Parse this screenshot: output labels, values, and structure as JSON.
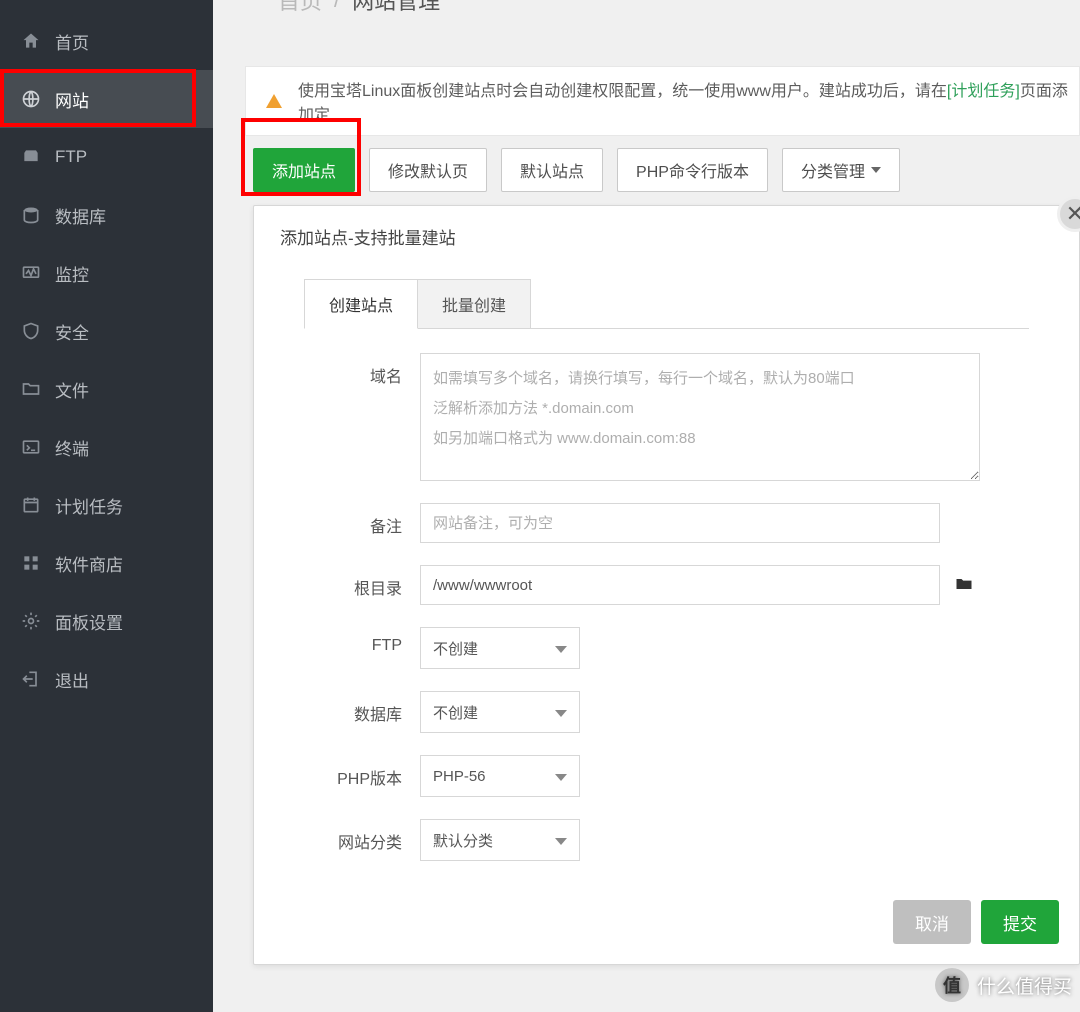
{
  "breadcrumb": {
    "home": "首页",
    "sep": "/",
    "current": "网站管理"
  },
  "sidebar": {
    "items": [
      {
        "label": "首页",
        "icon": "home-icon"
      },
      {
        "label": "网站",
        "icon": "globe-icon",
        "active": true
      },
      {
        "label": "FTP",
        "icon": "ftp-icon"
      },
      {
        "label": "数据库",
        "icon": "database-icon"
      },
      {
        "label": "监控",
        "icon": "monitor-icon"
      },
      {
        "label": "安全",
        "icon": "shield-icon"
      },
      {
        "label": "文件",
        "icon": "folder-icon"
      },
      {
        "label": "终端",
        "icon": "terminal-icon"
      },
      {
        "label": "计划任务",
        "icon": "calendar-icon"
      },
      {
        "label": "软件商店",
        "icon": "apps-icon"
      },
      {
        "label": "面板设置",
        "icon": "gear-icon"
      },
      {
        "label": "退出",
        "icon": "logout-icon"
      }
    ]
  },
  "alert": {
    "prefix": "使用宝塔Linux面板创建站点时会自动创建权限配置，统一使用www用户。建站成功后，请在",
    "link": "[计划任务]",
    "suffix": "页面添加定"
  },
  "toolbar": {
    "add": "添加站点",
    "modify": "修改默认页",
    "default": "默认站点",
    "phpcli": "PHP命令行版本",
    "category": "分类管理"
  },
  "modal": {
    "title": "添加站点-支持批量建站",
    "tabs": {
      "create": "创建站点",
      "batch": "批量创建"
    },
    "labels": {
      "domain": "域名",
      "note": "备注",
      "root": "根目录",
      "ftp": "FTP",
      "db": "数据库",
      "php": "PHP版本",
      "category": "网站分类"
    },
    "placeholders": {
      "domain": "如需填写多个域名，请换行填写，每行一个域名，默认为80端口\n泛解析添加方法 *.domain.com\n如另加端口格式为 www.domain.com:88",
      "note": "网站备注，可为空"
    },
    "values": {
      "root": "/www/wwwroot",
      "ftp": "不创建",
      "db": "不创建",
      "php": "PHP-56",
      "category": "默认分类"
    },
    "actions": {
      "cancel": "取消",
      "submit": "提交"
    }
  },
  "watermark": {
    "glyph": "值",
    "text": "什么值得买"
  }
}
